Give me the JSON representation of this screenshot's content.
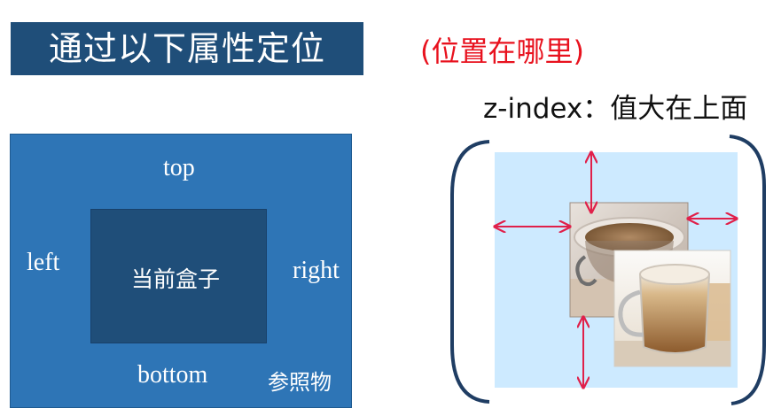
{
  "title": "通过以下属性定位",
  "subtitle": "(位置在哪里)",
  "zindex_note": "z-index：值大在上面",
  "left_diagram": {
    "top": "top",
    "left": "left",
    "right": "right",
    "bottom": "bottom",
    "current_box": "当前盒子",
    "reference": "参照物"
  },
  "colors": {
    "banner": "#1f4e79",
    "outer_box": "#2e75b6",
    "inner_box": "#1f4e79",
    "subtitle": "#e8121e",
    "arrow": "#e0204a",
    "bracket": "#1f3d63",
    "panel": "#cdeaff"
  },
  "icons": {
    "photo_back": "coffee-cup-photo",
    "photo_front": "latte-cup-photo"
  }
}
